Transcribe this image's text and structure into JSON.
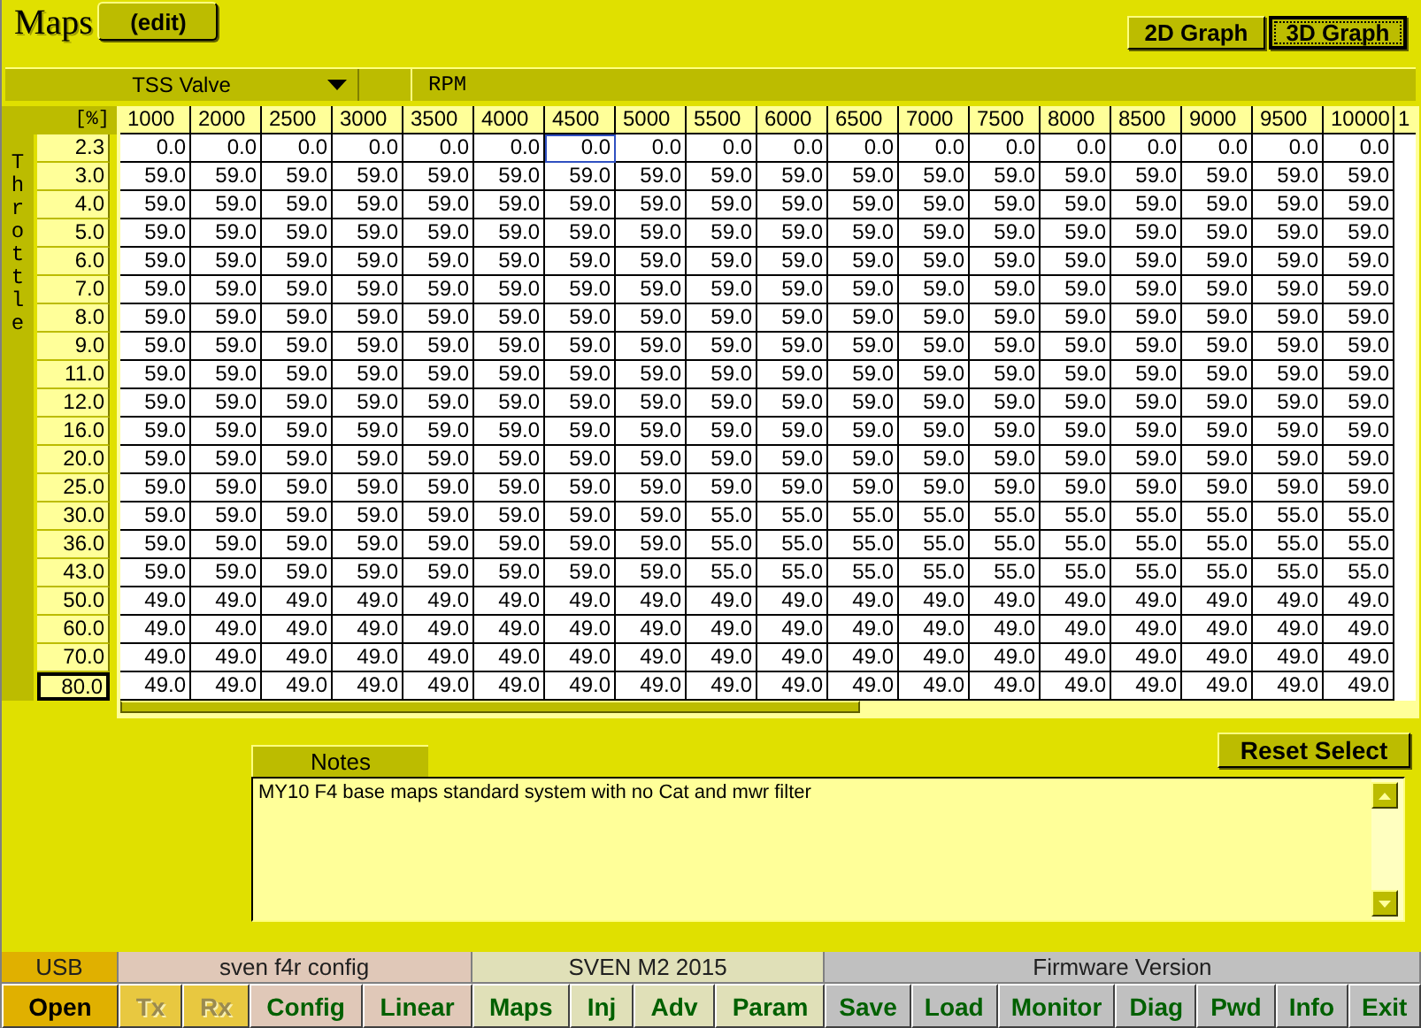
{
  "title": "Maps",
  "edit_button": "(edit)",
  "graph_tabs": [
    {
      "label": "2D Graph",
      "selected": false
    },
    {
      "label": "3D Graph",
      "selected": true
    }
  ],
  "map_selector": {
    "value": "TSS Valve"
  },
  "x_axis_label": "RPM",
  "y_axis_label": "Throttle",
  "unit_header": "[%]",
  "columns": [
    "1000",
    "2000",
    "2500",
    "3000",
    "3500",
    "4000",
    "4500",
    "5000",
    "5500",
    "6000",
    "6500",
    "7000",
    "7500",
    "8000",
    "8500",
    "9000",
    "9500",
    "10000",
    "1"
  ],
  "rows": [
    {
      "label": "2.3",
      "selected": false,
      "cells": [
        {
          "value": "0.0",
          "selected": false
        },
        {
          "value": "0.0",
          "selected": false
        },
        {
          "value": "0.0",
          "selected": false
        },
        {
          "value": "0.0",
          "selected": false
        },
        {
          "value": "0.0",
          "selected": false
        },
        {
          "value": "0.0",
          "selected": false
        },
        {
          "value": "0.0",
          "selected": true
        },
        {
          "value": "0.0",
          "selected": false
        },
        {
          "value": "0.0",
          "selected": false
        },
        {
          "value": "0.0",
          "selected": false
        },
        {
          "value": "0.0",
          "selected": false
        },
        {
          "value": "0.0",
          "selected": false
        },
        {
          "value": "0.0",
          "selected": false
        },
        {
          "value": "0.0",
          "selected": false
        },
        {
          "value": "0.0",
          "selected": false
        },
        {
          "value": "0.0",
          "selected": false
        },
        {
          "value": "0.0",
          "selected": false
        },
        {
          "value": "0.0",
          "selected": false
        }
      ]
    },
    {
      "label": "3.0",
      "selected": false,
      "cells": [
        {
          "value": "59.0",
          "selected": false
        },
        {
          "value": "59.0",
          "selected": false
        },
        {
          "value": "59.0",
          "selected": false
        },
        {
          "value": "59.0",
          "selected": false
        },
        {
          "value": "59.0",
          "selected": false
        },
        {
          "value": "59.0",
          "selected": false
        },
        {
          "value": "59.0",
          "selected": false
        },
        {
          "value": "59.0",
          "selected": false
        },
        {
          "value": "59.0",
          "selected": false
        },
        {
          "value": "59.0",
          "selected": false
        },
        {
          "value": "59.0",
          "selected": false
        },
        {
          "value": "59.0",
          "selected": false
        },
        {
          "value": "59.0",
          "selected": false
        },
        {
          "value": "59.0",
          "selected": false
        },
        {
          "value": "59.0",
          "selected": false
        },
        {
          "value": "59.0",
          "selected": false
        },
        {
          "value": "59.0",
          "selected": false
        },
        {
          "value": "59.0",
          "selected": false
        }
      ]
    },
    {
      "label": "4.0",
      "selected": false,
      "cells": [
        {
          "value": "59.0",
          "selected": false
        },
        {
          "value": "59.0",
          "selected": false
        },
        {
          "value": "59.0",
          "selected": false
        },
        {
          "value": "59.0",
          "selected": false
        },
        {
          "value": "59.0",
          "selected": false
        },
        {
          "value": "59.0",
          "selected": false
        },
        {
          "value": "59.0",
          "selected": false
        },
        {
          "value": "59.0",
          "selected": false
        },
        {
          "value": "59.0",
          "selected": false
        },
        {
          "value": "59.0",
          "selected": false
        },
        {
          "value": "59.0",
          "selected": false
        },
        {
          "value": "59.0",
          "selected": false
        },
        {
          "value": "59.0",
          "selected": false
        },
        {
          "value": "59.0",
          "selected": false
        },
        {
          "value": "59.0",
          "selected": false
        },
        {
          "value": "59.0",
          "selected": false
        },
        {
          "value": "59.0",
          "selected": false
        },
        {
          "value": "59.0",
          "selected": false
        }
      ]
    },
    {
      "label": "5.0",
      "selected": false,
      "cells": [
        {
          "value": "59.0",
          "selected": false
        },
        {
          "value": "59.0",
          "selected": false
        },
        {
          "value": "59.0",
          "selected": false
        },
        {
          "value": "59.0",
          "selected": false
        },
        {
          "value": "59.0",
          "selected": false
        },
        {
          "value": "59.0",
          "selected": false
        },
        {
          "value": "59.0",
          "selected": false
        },
        {
          "value": "59.0",
          "selected": false
        },
        {
          "value": "59.0",
          "selected": false
        },
        {
          "value": "59.0",
          "selected": false
        },
        {
          "value": "59.0",
          "selected": false
        },
        {
          "value": "59.0",
          "selected": false
        },
        {
          "value": "59.0",
          "selected": false
        },
        {
          "value": "59.0",
          "selected": false
        },
        {
          "value": "59.0",
          "selected": false
        },
        {
          "value": "59.0",
          "selected": false
        },
        {
          "value": "59.0",
          "selected": false
        },
        {
          "value": "59.0",
          "selected": false
        }
      ]
    },
    {
      "label": "6.0",
      "selected": false,
      "cells": [
        {
          "value": "59.0",
          "selected": false
        },
        {
          "value": "59.0",
          "selected": false
        },
        {
          "value": "59.0",
          "selected": false
        },
        {
          "value": "59.0",
          "selected": false
        },
        {
          "value": "59.0",
          "selected": false
        },
        {
          "value": "59.0",
          "selected": false
        },
        {
          "value": "59.0",
          "selected": false
        },
        {
          "value": "59.0",
          "selected": false
        },
        {
          "value": "59.0",
          "selected": false
        },
        {
          "value": "59.0",
          "selected": false
        },
        {
          "value": "59.0",
          "selected": false
        },
        {
          "value": "59.0",
          "selected": false
        },
        {
          "value": "59.0",
          "selected": false
        },
        {
          "value": "59.0",
          "selected": false
        },
        {
          "value": "59.0",
          "selected": false
        },
        {
          "value": "59.0",
          "selected": false
        },
        {
          "value": "59.0",
          "selected": false
        },
        {
          "value": "59.0",
          "selected": false
        }
      ]
    },
    {
      "label": "7.0",
      "selected": false,
      "cells": [
        {
          "value": "59.0",
          "selected": false
        },
        {
          "value": "59.0",
          "selected": false
        },
        {
          "value": "59.0",
          "selected": false
        },
        {
          "value": "59.0",
          "selected": false
        },
        {
          "value": "59.0",
          "selected": false
        },
        {
          "value": "59.0",
          "selected": false
        },
        {
          "value": "59.0",
          "selected": false
        },
        {
          "value": "59.0",
          "selected": false
        },
        {
          "value": "59.0",
          "selected": false
        },
        {
          "value": "59.0",
          "selected": false
        },
        {
          "value": "59.0",
          "selected": false
        },
        {
          "value": "59.0",
          "selected": false
        },
        {
          "value": "59.0",
          "selected": false
        },
        {
          "value": "59.0",
          "selected": false
        },
        {
          "value": "59.0",
          "selected": false
        },
        {
          "value": "59.0",
          "selected": false
        },
        {
          "value": "59.0",
          "selected": false
        },
        {
          "value": "59.0",
          "selected": false
        }
      ]
    },
    {
      "label": "8.0",
      "selected": false,
      "cells": [
        {
          "value": "59.0",
          "selected": false
        },
        {
          "value": "59.0",
          "selected": false
        },
        {
          "value": "59.0",
          "selected": false
        },
        {
          "value": "59.0",
          "selected": false
        },
        {
          "value": "59.0",
          "selected": false
        },
        {
          "value": "59.0",
          "selected": false
        },
        {
          "value": "59.0",
          "selected": false
        },
        {
          "value": "59.0",
          "selected": false
        },
        {
          "value": "59.0",
          "selected": false
        },
        {
          "value": "59.0",
          "selected": false
        },
        {
          "value": "59.0",
          "selected": false
        },
        {
          "value": "59.0",
          "selected": false
        },
        {
          "value": "59.0",
          "selected": false
        },
        {
          "value": "59.0",
          "selected": false
        },
        {
          "value": "59.0",
          "selected": false
        },
        {
          "value": "59.0",
          "selected": false
        },
        {
          "value": "59.0",
          "selected": false
        },
        {
          "value": "59.0",
          "selected": false
        }
      ]
    },
    {
      "label": "9.0",
      "selected": false,
      "cells": [
        {
          "value": "59.0",
          "selected": false
        },
        {
          "value": "59.0",
          "selected": false
        },
        {
          "value": "59.0",
          "selected": false
        },
        {
          "value": "59.0",
          "selected": false
        },
        {
          "value": "59.0",
          "selected": false
        },
        {
          "value": "59.0",
          "selected": false
        },
        {
          "value": "59.0",
          "selected": false
        },
        {
          "value": "59.0",
          "selected": false
        },
        {
          "value": "59.0",
          "selected": false
        },
        {
          "value": "59.0",
          "selected": false
        },
        {
          "value": "59.0",
          "selected": false
        },
        {
          "value": "59.0",
          "selected": false
        },
        {
          "value": "59.0",
          "selected": false
        },
        {
          "value": "59.0",
          "selected": false
        },
        {
          "value": "59.0",
          "selected": false
        },
        {
          "value": "59.0",
          "selected": false
        },
        {
          "value": "59.0",
          "selected": false
        },
        {
          "value": "59.0",
          "selected": false
        }
      ]
    },
    {
      "label": "11.0",
      "selected": false,
      "cells": [
        {
          "value": "59.0",
          "selected": false
        },
        {
          "value": "59.0",
          "selected": false
        },
        {
          "value": "59.0",
          "selected": false
        },
        {
          "value": "59.0",
          "selected": false
        },
        {
          "value": "59.0",
          "selected": false
        },
        {
          "value": "59.0",
          "selected": false
        },
        {
          "value": "59.0",
          "selected": false
        },
        {
          "value": "59.0",
          "selected": false
        },
        {
          "value": "59.0",
          "selected": false
        },
        {
          "value": "59.0",
          "selected": false
        },
        {
          "value": "59.0",
          "selected": false
        },
        {
          "value": "59.0",
          "selected": false
        },
        {
          "value": "59.0",
          "selected": false
        },
        {
          "value": "59.0",
          "selected": false
        },
        {
          "value": "59.0",
          "selected": false
        },
        {
          "value": "59.0",
          "selected": false
        },
        {
          "value": "59.0",
          "selected": false
        },
        {
          "value": "59.0",
          "selected": false
        }
      ]
    },
    {
      "label": "12.0",
      "selected": false,
      "cells": [
        {
          "value": "59.0",
          "selected": false
        },
        {
          "value": "59.0",
          "selected": false
        },
        {
          "value": "59.0",
          "selected": false
        },
        {
          "value": "59.0",
          "selected": false
        },
        {
          "value": "59.0",
          "selected": false
        },
        {
          "value": "59.0",
          "selected": false
        },
        {
          "value": "59.0",
          "selected": false
        },
        {
          "value": "59.0",
          "selected": false
        },
        {
          "value": "59.0",
          "selected": false
        },
        {
          "value": "59.0",
          "selected": false
        },
        {
          "value": "59.0",
          "selected": false
        },
        {
          "value": "59.0",
          "selected": false
        },
        {
          "value": "59.0",
          "selected": false
        },
        {
          "value": "59.0",
          "selected": false
        },
        {
          "value": "59.0",
          "selected": false
        },
        {
          "value": "59.0",
          "selected": false
        },
        {
          "value": "59.0",
          "selected": false
        },
        {
          "value": "59.0",
          "selected": false
        }
      ]
    },
    {
      "label": "16.0",
      "selected": false,
      "cells": [
        {
          "value": "59.0",
          "selected": false
        },
        {
          "value": "59.0",
          "selected": false
        },
        {
          "value": "59.0",
          "selected": false
        },
        {
          "value": "59.0",
          "selected": false
        },
        {
          "value": "59.0",
          "selected": false
        },
        {
          "value": "59.0",
          "selected": false
        },
        {
          "value": "59.0",
          "selected": false
        },
        {
          "value": "59.0",
          "selected": false
        },
        {
          "value": "59.0",
          "selected": false
        },
        {
          "value": "59.0",
          "selected": false
        },
        {
          "value": "59.0",
          "selected": false
        },
        {
          "value": "59.0",
          "selected": false
        },
        {
          "value": "59.0",
          "selected": false
        },
        {
          "value": "59.0",
          "selected": false
        },
        {
          "value": "59.0",
          "selected": false
        },
        {
          "value": "59.0",
          "selected": false
        },
        {
          "value": "59.0",
          "selected": false
        },
        {
          "value": "59.0",
          "selected": false
        }
      ]
    },
    {
      "label": "20.0",
      "selected": false,
      "cells": [
        {
          "value": "59.0",
          "selected": false
        },
        {
          "value": "59.0",
          "selected": false
        },
        {
          "value": "59.0",
          "selected": false
        },
        {
          "value": "59.0",
          "selected": false
        },
        {
          "value": "59.0",
          "selected": false
        },
        {
          "value": "59.0",
          "selected": false
        },
        {
          "value": "59.0",
          "selected": false
        },
        {
          "value": "59.0",
          "selected": false
        },
        {
          "value": "59.0",
          "selected": false
        },
        {
          "value": "59.0",
          "selected": false
        },
        {
          "value": "59.0",
          "selected": false
        },
        {
          "value": "59.0",
          "selected": false
        },
        {
          "value": "59.0",
          "selected": false
        },
        {
          "value": "59.0",
          "selected": false
        },
        {
          "value": "59.0",
          "selected": false
        },
        {
          "value": "59.0",
          "selected": false
        },
        {
          "value": "59.0",
          "selected": false
        },
        {
          "value": "59.0",
          "selected": false
        }
      ]
    },
    {
      "label": "25.0",
      "selected": false,
      "cells": [
        {
          "value": "59.0",
          "selected": false
        },
        {
          "value": "59.0",
          "selected": false
        },
        {
          "value": "59.0",
          "selected": false
        },
        {
          "value": "59.0",
          "selected": false
        },
        {
          "value": "59.0",
          "selected": false
        },
        {
          "value": "59.0",
          "selected": false
        },
        {
          "value": "59.0",
          "selected": false
        },
        {
          "value": "59.0",
          "selected": false
        },
        {
          "value": "59.0",
          "selected": false
        },
        {
          "value": "59.0",
          "selected": false
        },
        {
          "value": "59.0",
          "selected": false
        },
        {
          "value": "59.0",
          "selected": false
        },
        {
          "value": "59.0",
          "selected": false
        },
        {
          "value": "59.0",
          "selected": false
        },
        {
          "value": "59.0",
          "selected": false
        },
        {
          "value": "59.0",
          "selected": false
        },
        {
          "value": "59.0",
          "selected": false
        },
        {
          "value": "59.0",
          "selected": false
        }
      ]
    },
    {
      "label": "30.0",
      "selected": false,
      "cells": [
        {
          "value": "59.0",
          "selected": false
        },
        {
          "value": "59.0",
          "selected": false
        },
        {
          "value": "59.0",
          "selected": false
        },
        {
          "value": "59.0",
          "selected": false
        },
        {
          "value": "59.0",
          "selected": false
        },
        {
          "value": "59.0",
          "selected": false
        },
        {
          "value": "59.0",
          "selected": false
        },
        {
          "value": "59.0",
          "selected": false
        },
        {
          "value": "55.0",
          "selected": false
        },
        {
          "value": "55.0",
          "selected": false
        },
        {
          "value": "55.0",
          "selected": false
        },
        {
          "value": "55.0",
          "selected": false
        },
        {
          "value": "55.0",
          "selected": false
        },
        {
          "value": "55.0",
          "selected": false
        },
        {
          "value": "55.0",
          "selected": false
        },
        {
          "value": "55.0",
          "selected": false
        },
        {
          "value": "55.0",
          "selected": false
        },
        {
          "value": "55.0",
          "selected": false
        }
      ]
    },
    {
      "label": "36.0",
      "selected": false,
      "cells": [
        {
          "value": "59.0",
          "selected": false
        },
        {
          "value": "59.0",
          "selected": false
        },
        {
          "value": "59.0",
          "selected": false
        },
        {
          "value": "59.0",
          "selected": false
        },
        {
          "value": "59.0",
          "selected": false
        },
        {
          "value": "59.0",
          "selected": false
        },
        {
          "value": "59.0",
          "selected": false
        },
        {
          "value": "59.0",
          "selected": false
        },
        {
          "value": "55.0",
          "selected": false
        },
        {
          "value": "55.0",
          "selected": false
        },
        {
          "value": "55.0",
          "selected": false
        },
        {
          "value": "55.0",
          "selected": false
        },
        {
          "value": "55.0",
          "selected": false
        },
        {
          "value": "55.0",
          "selected": false
        },
        {
          "value": "55.0",
          "selected": false
        },
        {
          "value": "55.0",
          "selected": false
        },
        {
          "value": "55.0",
          "selected": false
        },
        {
          "value": "55.0",
          "selected": false
        }
      ]
    },
    {
      "label": "43.0",
      "selected": false,
      "cells": [
        {
          "value": "59.0",
          "selected": false
        },
        {
          "value": "59.0",
          "selected": false
        },
        {
          "value": "59.0",
          "selected": false
        },
        {
          "value": "59.0",
          "selected": false
        },
        {
          "value": "59.0",
          "selected": false
        },
        {
          "value": "59.0",
          "selected": false
        },
        {
          "value": "59.0",
          "selected": false
        },
        {
          "value": "59.0",
          "selected": false
        },
        {
          "value": "55.0",
          "selected": false
        },
        {
          "value": "55.0",
          "selected": false
        },
        {
          "value": "55.0",
          "selected": false
        },
        {
          "value": "55.0",
          "selected": false
        },
        {
          "value": "55.0",
          "selected": false
        },
        {
          "value": "55.0",
          "selected": false
        },
        {
          "value": "55.0",
          "selected": false
        },
        {
          "value": "55.0",
          "selected": false
        },
        {
          "value": "55.0",
          "selected": false
        },
        {
          "value": "55.0",
          "selected": false
        }
      ]
    },
    {
      "label": "50.0",
      "selected": false,
      "cells": [
        {
          "value": "49.0",
          "selected": false
        },
        {
          "value": "49.0",
          "selected": false
        },
        {
          "value": "49.0",
          "selected": false
        },
        {
          "value": "49.0",
          "selected": false
        },
        {
          "value": "49.0",
          "selected": false
        },
        {
          "value": "49.0",
          "selected": false
        },
        {
          "value": "49.0",
          "selected": false
        },
        {
          "value": "49.0",
          "selected": false
        },
        {
          "value": "49.0",
          "selected": false
        },
        {
          "value": "49.0",
          "selected": false
        },
        {
          "value": "49.0",
          "selected": false
        },
        {
          "value": "49.0",
          "selected": false
        },
        {
          "value": "49.0",
          "selected": false
        },
        {
          "value": "49.0",
          "selected": false
        },
        {
          "value": "49.0",
          "selected": false
        },
        {
          "value": "49.0",
          "selected": false
        },
        {
          "value": "49.0",
          "selected": false
        },
        {
          "value": "49.0",
          "selected": false
        }
      ]
    },
    {
      "label": "60.0",
      "selected": false,
      "cells": [
        {
          "value": "49.0",
          "selected": false
        },
        {
          "value": "49.0",
          "selected": false
        },
        {
          "value": "49.0",
          "selected": false
        },
        {
          "value": "49.0",
          "selected": false
        },
        {
          "value": "49.0",
          "selected": false
        },
        {
          "value": "49.0",
          "selected": false
        },
        {
          "value": "49.0",
          "selected": false
        },
        {
          "value": "49.0",
          "selected": false
        },
        {
          "value": "49.0",
          "selected": false
        },
        {
          "value": "49.0",
          "selected": false
        },
        {
          "value": "49.0",
          "selected": false
        },
        {
          "value": "49.0",
          "selected": false
        },
        {
          "value": "49.0",
          "selected": false
        },
        {
          "value": "49.0",
          "selected": false
        },
        {
          "value": "49.0",
          "selected": false
        },
        {
          "value": "49.0",
          "selected": false
        },
        {
          "value": "49.0",
          "selected": false
        },
        {
          "value": "49.0",
          "selected": false
        }
      ]
    },
    {
      "label": "70.0",
      "selected": false,
      "cells": [
        {
          "value": "49.0",
          "selected": false
        },
        {
          "value": "49.0",
          "selected": false
        },
        {
          "value": "49.0",
          "selected": false
        },
        {
          "value": "49.0",
          "selected": false
        },
        {
          "value": "49.0",
          "selected": false
        },
        {
          "value": "49.0",
          "selected": false
        },
        {
          "value": "49.0",
          "selected": false
        },
        {
          "value": "49.0",
          "selected": false
        },
        {
          "value": "49.0",
          "selected": false
        },
        {
          "value": "49.0",
          "selected": false
        },
        {
          "value": "49.0",
          "selected": false
        },
        {
          "value": "49.0",
          "selected": false
        },
        {
          "value": "49.0",
          "selected": false
        },
        {
          "value": "49.0",
          "selected": false
        },
        {
          "value": "49.0",
          "selected": false
        },
        {
          "value": "49.0",
          "selected": false
        },
        {
          "value": "49.0",
          "selected": false
        },
        {
          "value": "49.0",
          "selected": false
        }
      ]
    },
    {
      "label": "80.0",
      "selected": true,
      "cells": [
        {
          "value": "49.0",
          "selected": false
        },
        {
          "value": "49.0",
          "selected": false
        },
        {
          "value": "49.0",
          "selected": false
        },
        {
          "value": "49.0",
          "selected": false
        },
        {
          "value": "49.0",
          "selected": false
        },
        {
          "value": "49.0",
          "selected": false
        },
        {
          "value": "49.0",
          "selected": false
        },
        {
          "value": "49.0",
          "selected": false
        },
        {
          "value": "49.0",
          "selected": false
        },
        {
          "value": "49.0",
          "selected": false
        },
        {
          "value": "49.0",
          "selected": false
        },
        {
          "value": "49.0",
          "selected": false
        },
        {
          "value": "49.0",
          "selected": false
        },
        {
          "value": "49.0",
          "selected": false
        },
        {
          "value": "49.0",
          "selected": false
        },
        {
          "value": "49.0",
          "selected": false
        },
        {
          "value": "49.0",
          "selected": false
        },
        {
          "value": "49.0",
          "selected": false
        }
      ]
    }
  ],
  "reset_button": "Reset Select",
  "notes": {
    "header": "Notes",
    "value": "MY10 F4 base maps standard system with no Cat and mwr filter"
  },
  "status_sections": [
    {
      "kind": "port",
      "label": "USB",
      "buttons": [
        {
          "label": "Open",
          "disabled": false
        }
      ]
    },
    {
      "kind": "config",
      "label": "sven f4r config",
      "buttons": [
        {
          "label": "Tx",
          "disabled": true
        },
        {
          "label": "Rx",
          "disabled": true
        },
        {
          "label": "Config",
          "disabled": false
        },
        {
          "label": "Linear",
          "disabled": false
        }
      ]
    },
    {
      "kind": "map",
      "label": "SVEN M2 2015",
      "buttons": [
        {
          "label": "Maps",
          "disabled": false
        },
        {
          "label": "Inj",
          "disabled": false
        },
        {
          "label": "Adv",
          "disabled": false
        },
        {
          "label": "Param",
          "disabled": false
        }
      ]
    },
    {
      "kind": "firmware",
      "label": "Firmware Version",
      "buttons": [
        {
          "label": "Save",
          "disabled": false
        },
        {
          "label": "Load",
          "disabled": false
        },
        {
          "label": "Monitor",
          "disabled": false
        },
        {
          "label": "Diag",
          "disabled": false
        },
        {
          "label": "Pwd",
          "disabled": false
        },
        {
          "label": "Info",
          "disabled": false
        },
        {
          "label": "Exit",
          "disabled": false
        }
      ]
    }
  ]
}
